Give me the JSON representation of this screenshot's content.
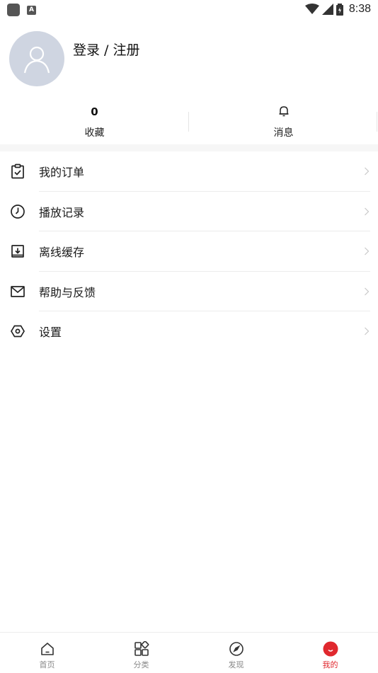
{
  "status_bar": {
    "time": "8:38"
  },
  "profile": {
    "login_text": "登录 / 注册"
  },
  "stats": {
    "favorites": {
      "count": "0",
      "label": "收藏"
    },
    "messages": {
      "label": "消息"
    }
  },
  "menu": {
    "items": [
      {
        "label": "我的订单",
        "icon": "clipboard-check-icon"
      },
      {
        "label": "播放记录",
        "icon": "clock-icon"
      },
      {
        "label": "离线缓存",
        "icon": "download-icon"
      },
      {
        "label": "帮助与反馈",
        "icon": "mail-icon"
      },
      {
        "label": "设置",
        "icon": "settings-hexagon-icon"
      }
    ]
  },
  "bottom_nav": {
    "items": [
      {
        "label": "首页",
        "icon": "home-icon"
      },
      {
        "label": "分类",
        "icon": "category-grid-icon"
      },
      {
        "label": "发现",
        "icon": "compass-icon"
      },
      {
        "label": "我的",
        "icon": "profile-icon",
        "active": true
      }
    ],
    "active_color": "#e0282e"
  }
}
